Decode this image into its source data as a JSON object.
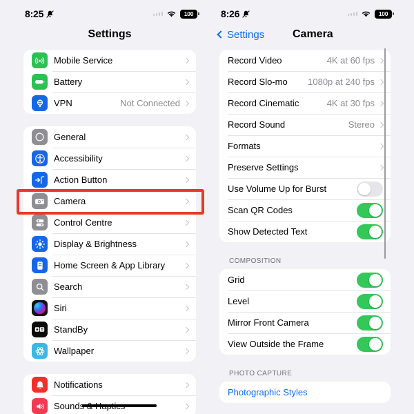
{
  "left_panel": {
    "status_bar": {
      "time": "8:25",
      "silent_icon": "bell-slash-icon",
      "battery": "100"
    },
    "nav": {
      "title": "Settings"
    },
    "groups": [
      {
        "id": "connectivity",
        "rows": [
          {
            "label": "Mobile Service",
            "icon": "mobile-service-icon",
            "detail": "",
            "chevron": true
          },
          {
            "label": "Battery",
            "icon": "battery-icon",
            "detail": "",
            "chevron": true
          },
          {
            "label": "VPN",
            "icon": "vpn-icon",
            "detail": "Not Connected",
            "chevron": true
          }
        ]
      },
      {
        "id": "system",
        "rows": [
          {
            "label": "General",
            "icon": "general-gear-icon",
            "detail": "",
            "chevron": true
          },
          {
            "label": "Accessibility",
            "icon": "accessibility-icon",
            "detail": "",
            "chevron": true
          },
          {
            "label": "Action Button",
            "icon": "action-button-icon",
            "detail": "",
            "chevron": true
          },
          {
            "label": "Camera",
            "icon": "camera-icon",
            "detail": "",
            "chevron": true
          },
          {
            "label": "Control Centre",
            "icon": "control-centre-icon",
            "detail": "",
            "chevron": true
          },
          {
            "label": "Display & Brightness",
            "icon": "brightness-icon",
            "detail": "",
            "chevron": true
          },
          {
            "label": "Home Screen & App Library",
            "icon": "home-screen-icon",
            "detail": "",
            "chevron": true
          },
          {
            "label": "Search",
            "icon": "search-icon",
            "detail": "",
            "chevron": true
          },
          {
            "label": "Siri",
            "icon": "siri-icon",
            "detail": "",
            "chevron": true
          },
          {
            "label": "StandBy",
            "icon": "standby-icon",
            "detail": "",
            "chevron": true
          },
          {
            "label": "Wallpaper",
            "icon": "wallpaper-icon",
            "detail": "",
            "chevron": true
          }
        ]
      },
      {
        "id": "alerts",
        "rows": [
          {
            "label": "Notifications",
            "icon": "notifications-bell-icon",
            "detail": "",
            "chevron": true
          },
          {
            "label": "Sounds & Haptics",
            "icon": "sounds-haptics-icon",
            "detail": "",
            "chevron": true
          }
        ]
      }
    ],
    "highlight": "Camera"
  },
  "right_panel": {
    "status_bar": {
      "time": "8:26",
      "silent_icon": "bell-slash-icon",
      "battery": "100"
    },
    "nav": {
      "back_label": "Settings",
      "title": "Camera"
    },
    "groups": [
      {
        "id": "capture",
        "header": "",
        "rows": [
          {
            "label": "Record Video",
            "type": "link",
            "detail": "4K at 60 fps"
          },
          {
            "label": "Record Slo-mo",
            "type": "link",
            "detail": "1080p at 240 fps"
          },
          {
            "label": "Record Cinematic",
            "type": "link",
            "detail": "4K at 30 fps"
          },
          {
            "label": "Record Sound",
            "type": "link",
            "detail": "Stereo"
          },
          {
            "label": "Formats",
            "type": "link",
            "detail": ""
          },
          {
            "label": "Preserve Settings",
            "type": "link",
            "detail": ""
          },
          {
            "label": "Use Volume Up for Burst",
            "type": "toggle",
            "on": false
          },
          {
            "label": "Scan QR Codes",
            "type": "toggle",
            "on": true
          },
          {
            "label": "Show Detected Text",
            "type": "toggle",
            "on": true
          }
        ]
      },
      {
        "id": "composition",
        "header": "COMPOSITION",
        "rows": [
          {
            "label": "Grid",
            "type": "toggle",
            "on": true
          },
          {
            "label": "Level",
            "type": "toggle",
            "on": true
          },
          {
            "label": "Mirror Front Camera",
            "type": "toggle",
            "on": true
          },
          {
            "label": "View Outside the Frame",
            "type": "toggle",
            "on": true
          }
        ]
      },
      {
        "id": "photo_capture",
        "header": "PHOTO CAPTURE",
        "rows": [
          {
            "label": "Photographic Styles",
            "type": "bluelink",
            "detail": ""
          }
        ]
      }
    ],
    "highlight": "Record Sound"
  },
  "colors": {
    "accent_blue": "#0a6cf5",
    "toggle_on": "#34c759",
    "annotation_red": "#e8392b",
    "page_bg": "#f1f1f6"
  }
}
